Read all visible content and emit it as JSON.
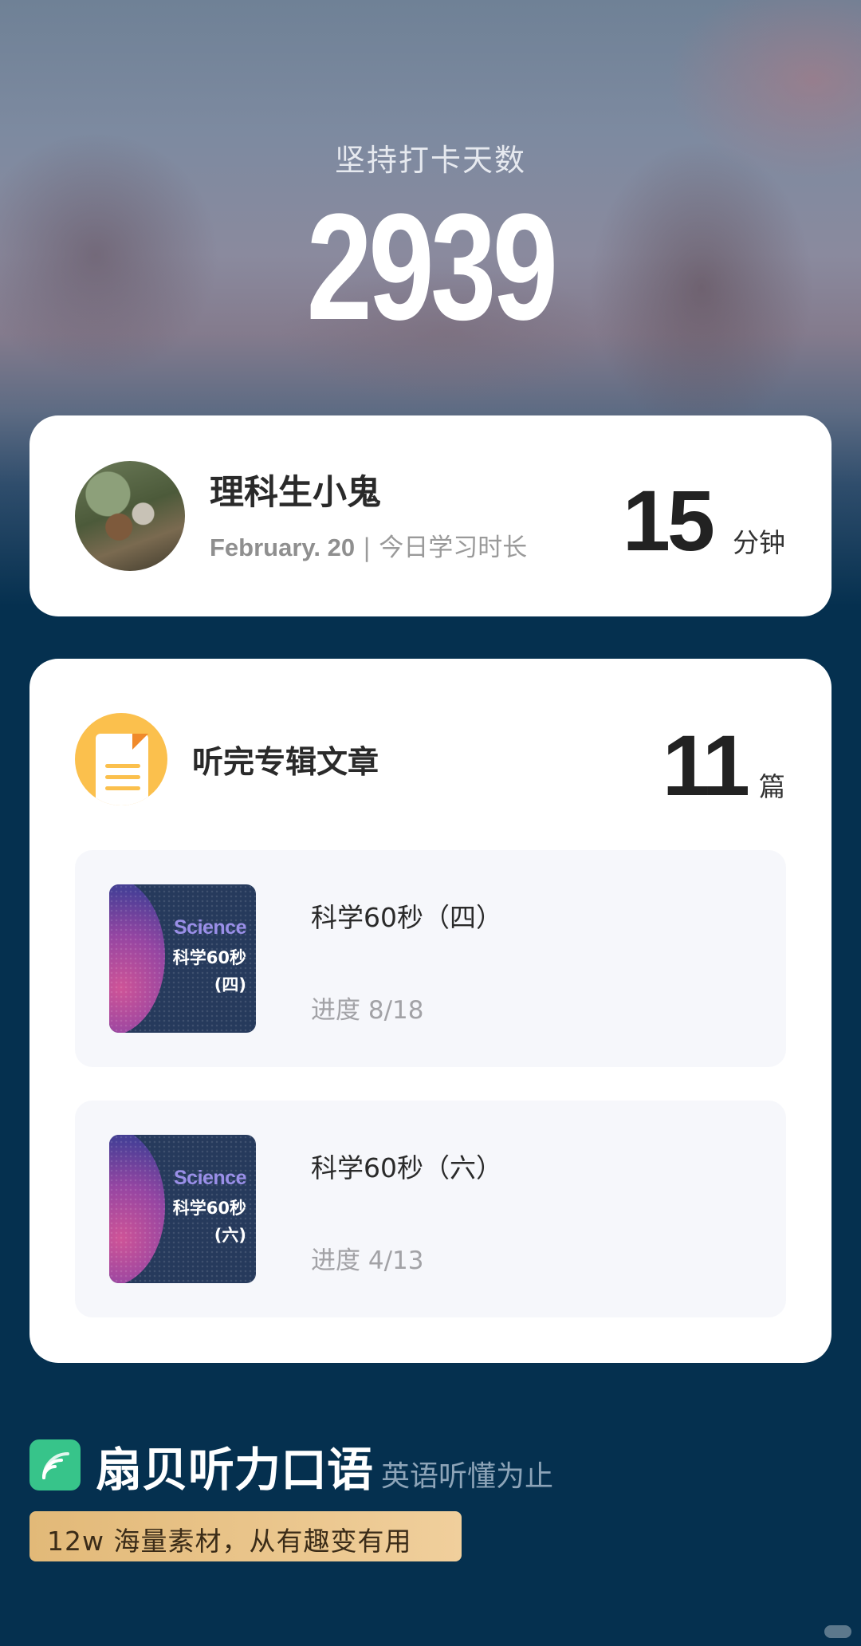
{
  "header": {
    "title": "坚持打卡天数",
    "streak_days": "2939"
  },
  "profile_card": {
    "user_name": "理科生小鬼",
    "date": "February. 20",
    "separator": " | ",
    "today_label": "今日学习时长",
    "today_minutes": "15",
    "minutes_unit": "分钟"
  },
  "articles_card": {
    "label": "听完专辑文章",
    "count": "11",
    "unit": "篇",
    "albums": [
      {
        "title": "科学60秒（四）",
        "progress": "进度 8/18",
        "cover_science": "Science",
        "cover_line1": "科学60秒",
        "cover_line2": "(四)"
      },
      {
        "title": "科学60秒（六）",
        "progress": "进度 4/13",
        "cover_science": "Science",
        "cover_line1": "科学60秒",
        "cover_line2": "(六)"
      }
    ]
  },
  "brand": {
    "name": "扇贝听力口语",
    "slogan": "英语听懂为止",
    "promo": "12w 海量素材，从有趣变有用"
  },
  "colors": {
    "background_dark": "#05304f",
    "card": "#ffffff",
    "doc_icon": "#fbc04d",
    "brand_green": "#37c48a",
    "promo_gold": "#e2b978"
  },
  "icons": [
    "document-icon",
    "shanbay-logo-icon"
  ]
}
